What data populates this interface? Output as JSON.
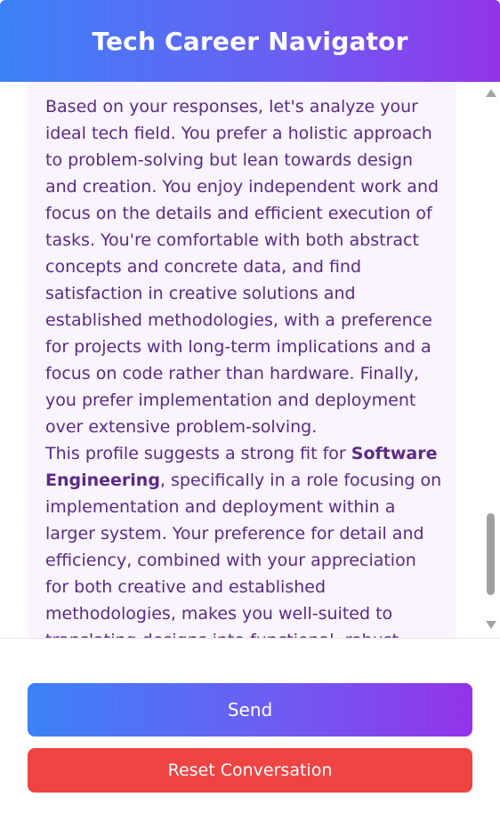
{
  "header": {
    "title": "Tech Career Navigator"
  },
  "chat": {
    "message": {
      "paragraph1": "Based on your responses, let's analyze your ideal tech field. You prefer a holistic approach to problem-solving but lean towards design and creation. You enjoy independent work and focus on the details and efficient execution of tasks. You're comfortable with both abstract concepts and concrete data, and find satisfaction in creative solutions and established methodologies, with a preference for projects with long-term implications and a focus on code rather than hardware. Finally, you prefer implementation and deployment over extensive problem-solving.",
      "paragraph2_before": "This profile suggests a strong fit for ",
      "paragraph2_bold": "Software Engineering",
      "paragraph2_after": ", specifically in a role focusing on implementation and deployment within a larger system. Your preference for detail and efficiency, combined with your appreciation for both creative and established methodologies, makes you well-suited to translating designs into functional, robust software. Your preference for long-term implications points towards a career"
    }
  },
  "controls": {
    "send_label": "Send",
    "reset_label": "Reset Conversation"
  },
  "colors": {
    "gradient_start": "#3b82f6",
    "gradient_end": "#9333ea",
    "message_text": "#5b2a86",
    "message_bg": "#f9f4fd",
    "reset_button": "#ef4444"
  }
}
